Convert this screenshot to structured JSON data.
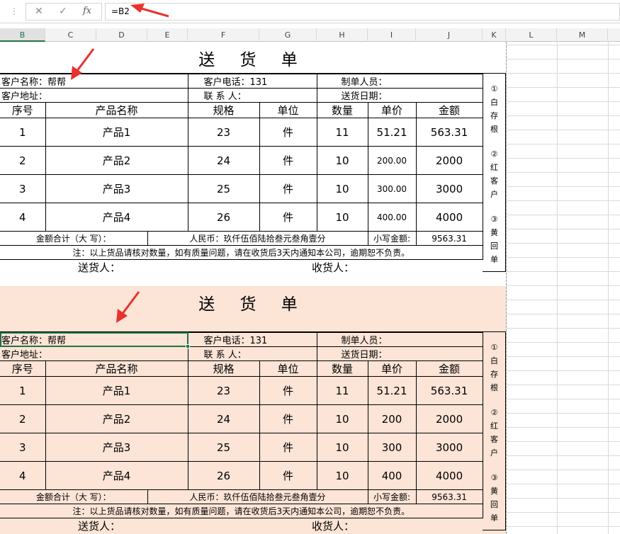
{
  "formula_bar": {
    "grip": "⋮",
    "cancel_glyph": "✕",
    "enter_glyph": "✓",
    "fx_label": "fx",
    "formula": "=B2"
  },
  "columns": [
    "B",
    "C",
    "D",
    "E",
    "F",
    "G",
    "H",
    "I",
    "J",
    "K",
    "L",
    "M"
  ],
  "selected_column": "B",
  "forms": [
    {
      "title": "送 货 单",
      "customer_name_label": "客户名称：帮帮",
      "customer_phone_label": "客户电话：131",
      "maker_label": "制单人员：",
      "address_label": "客户地址：",
      "contact_label": "联 系 人：",
      "delivery_date_label": "送货日期：",
      "headers": [
        "序号",
        "产品名称",
        "规格",
        "单位",
        "数量",
        "单价",
        "金额"
      ],
      "rows": [
        [
          "1",
          "产品1",
          "23",
          "件",
          "11",
          "51.21",
          "563.31"
        ],
        [
          "2",
          "产品2",
          "24",
          "件",
          "10",
          "200.00",
          "2000"
        ],
        [
          "3",
          "产品3",
          "25",
          "件",
          "10",
          "300.00",
          "3000"
        ],
        [
          "4",
          "产品4",
          "26",
          "件",
          "10",
          "400.00",
          "4000"
        ]
      ],
      "total_label": "金额合计（大 写）：",
      "rmb_text": "人民币：玖仟伍佰陆拾叁元叁角壹分",
      "small_label": "小写金额:",
      "small_value": "9563.31",
      "note": "注：以上货品请核对数量，如有质量问题，请在收货后3天内通知本公司，逾期恕不负责。",
      "sender_label": "送货人：",
      "receiver_label": "收货人：",
      "side_groups": [
        [
          "①",
          "白",
          "存",
          "根"
        ],
        [
          "②",
          "红",
          "客",
          "户"
        ],
        [
          "③",
          "黄",
          "回",
          "单"
        ]
      ]
    },
    {
      "title": "送 货 单",
      "customer_name_label": "客户名称：帮帮",
      "customer_phone_label": "客户电话：131",
      "maker_label": "制单人员：",
      "address_label": "客户地址：",
      "contact_label": "联 系 人：",
      "delivery_date_label": "送货日期：",
      "headers": [
        "序号",
        "产品名称",
        "规格",
        "单位",
        "数量",
        "单价",
        "金额"
      ],
      "rows": [
        [
          "1",
          "产品1",
          "23",
          "件",
          "11",
          "51.21",
          "563.31"
        ],
        [
          "2",
          "产品2",
          "24",
          "件",
          "10",
          "200",
          "2000"
        ],
        [
          "3",
          "产品3",
          "25",
          "件",
          "10",
          "300",
          "3000"
        ],
        [
          "4",
          "产品4",
          "26",
          "件",
          "10",
          "400",
          "4000"
        ]
      ],
      "total_label": "金额合计（大 写）：",
      "rmb_text": "人民币：玖仟伍佰陆拾叁元叁角壹分",
      "small_label": "小写金额:",
      "small_value": "9563.31",
      "note": "注：以上货品请核对数量，如有质量问题，请在收货后3天内通知本公司，逾期恕不负责。",
      "sender_label": "送货人：",
      "receiver_label": "收货人：",
      "side_groups": [
        [
          "①",
          "白",
          "存",
          "根"
        ],
        [
          "②",
          "红",
          "客",
          "户"
        ],
        [
          "③",
          "黄",
          "回",
          "单"
        ]
      ]
    }
  ],
  "colors": {
    "pink_fill": "#fce4d6",
    "annotation_red": "#e8322d",
    "selection_green": "#217346"
  }
}
